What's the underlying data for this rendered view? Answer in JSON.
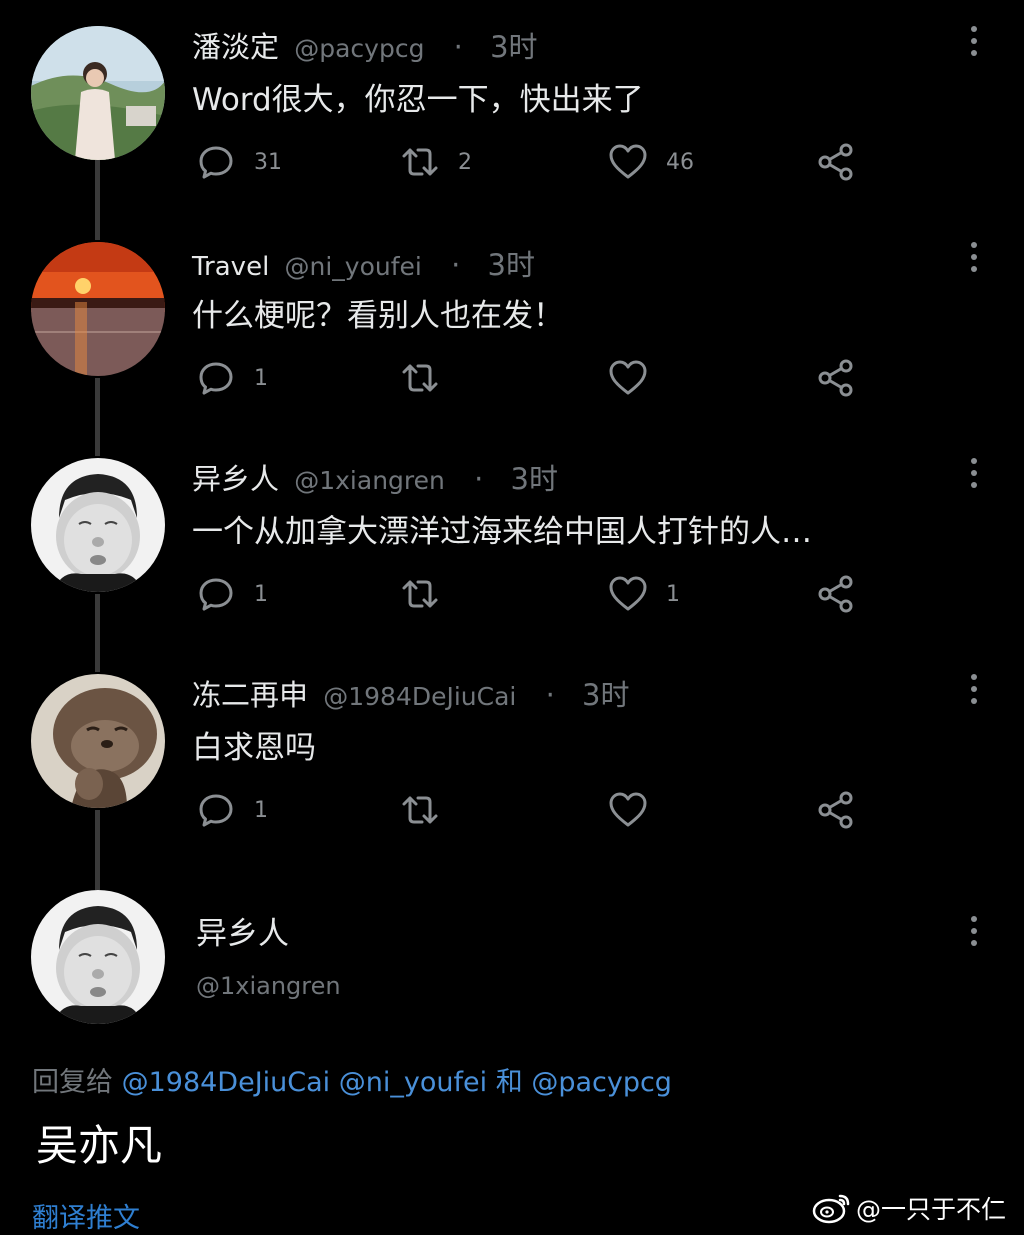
{
  "tweets": [
    {
      "name": "潘淡定",
      "handle": "@pacypcg",
      "time": "3时",
      "text": "Word很大，你忍一下，快出来了",
      "reply_count": "31",
      "retweet_count": "2",
      "like_count": "46"
    },
    {
      "name": "Travel",
      "handle": "@ni_youfei",
      "time": "3时",
      "text": "什么梗呢？看别人也在发！",
      "reply_count": "1",
      "retweet_count": "",
      "like_count": ""
    },
    {
      "name": "异乡人",
      "handle": "@1xiangren",
      "time": "3时",
      "text": "一个从加拿大漂洋过海来给中国人打针的人…",
      "reply_count": "1",
      "retweet_count": "",
      "like_count": "1"
    },
    {
      "name": "冻二再申",
      "handle": "@1984DeJiuCai",
      "time": "3时",
      "text": "白求恩吗",
      "reply_count": "1",
      "retweet_count": "",
      "like_count": ""
    }
  ],
  "separator": "·",
  "focus": {
    "name": "异乡人",
    "handle": "@1xiangren",
    "reply_to_label": "回复给",
    "mentions": [
      "@1984DeJiuCai",
      "@ni_youfei"
    ],
    "and_label": "和",
    "last_mention": "@pacypcg",
    "text": "吴亦凡",
    "translate_label": "翻译推文"
  },
  "watermark": "@一只于不仁",
  "icons": {
    "reply": "reply-bubble-icon",
    "retweet": "retweet-icon",
    "like": "heart-icon",
    "share": "share-icon",
    "more": "more-vertical-icon"
  },
  "colors": {
    "background": "#000000",
    "text": "#e7e9ea",
    "muted": "#71767b",
    "link": "#4a90d9"
  }
}
